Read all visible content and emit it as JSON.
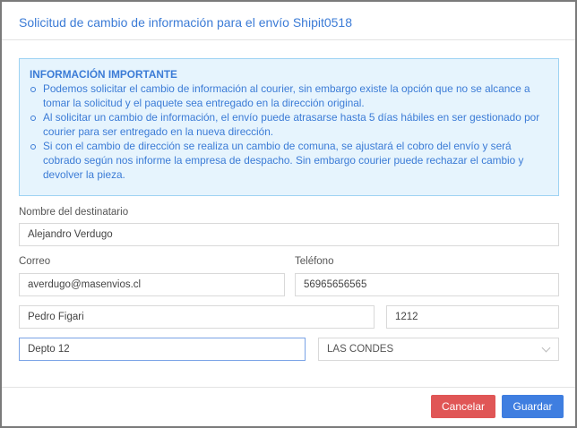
{
  "modal": {
    "title": "Solicitud de cambio de información para el envío Shipit0518"
  },
  "info": {
    "heading": "INFORMACIÓN IMPORTANTE",
    "items": [
      "Podemos solicitar el cambio de información al courier, sin embargo existe la opción que no se alcance a tomar la solicitud y el paquete sea entregado en la dirección original.",
      "Al solicitar un cambio de información, el envío puede atrasarse hasta 5 días hábiles en ser gestionado por courier para ser entregado en la nueva dirección.",
      "Si con el cambio de dirección se realiza un cambio de comuna, se ajustará el cobro del envío y será cobrado según nos informe la empresa de despacho. Sin embargo courier puede rechazar el cambio y devolver la pieza."
    ]
  },
  "form": {
    "name_label": "Nombre del destinatario",
    "name": "Alejandro Verdugo",
    "email_label": "Correo",
    "email": "averdugo@masenvios.cl",
    "phone_label": "Teléfono",
    "phone": "56965656565",
    "street": "Pedro Figari",
    "number": "1212",
    "complement": "Depto 12",
    "commune": "LAS CONDES"
  },
  "footer": {
    "cancel": "Cancelar",
    "save": "Guardar"
  },
  "colors": {
    "primary": "#3f7ee0",
    "danger": "#e05656"
  }
}
